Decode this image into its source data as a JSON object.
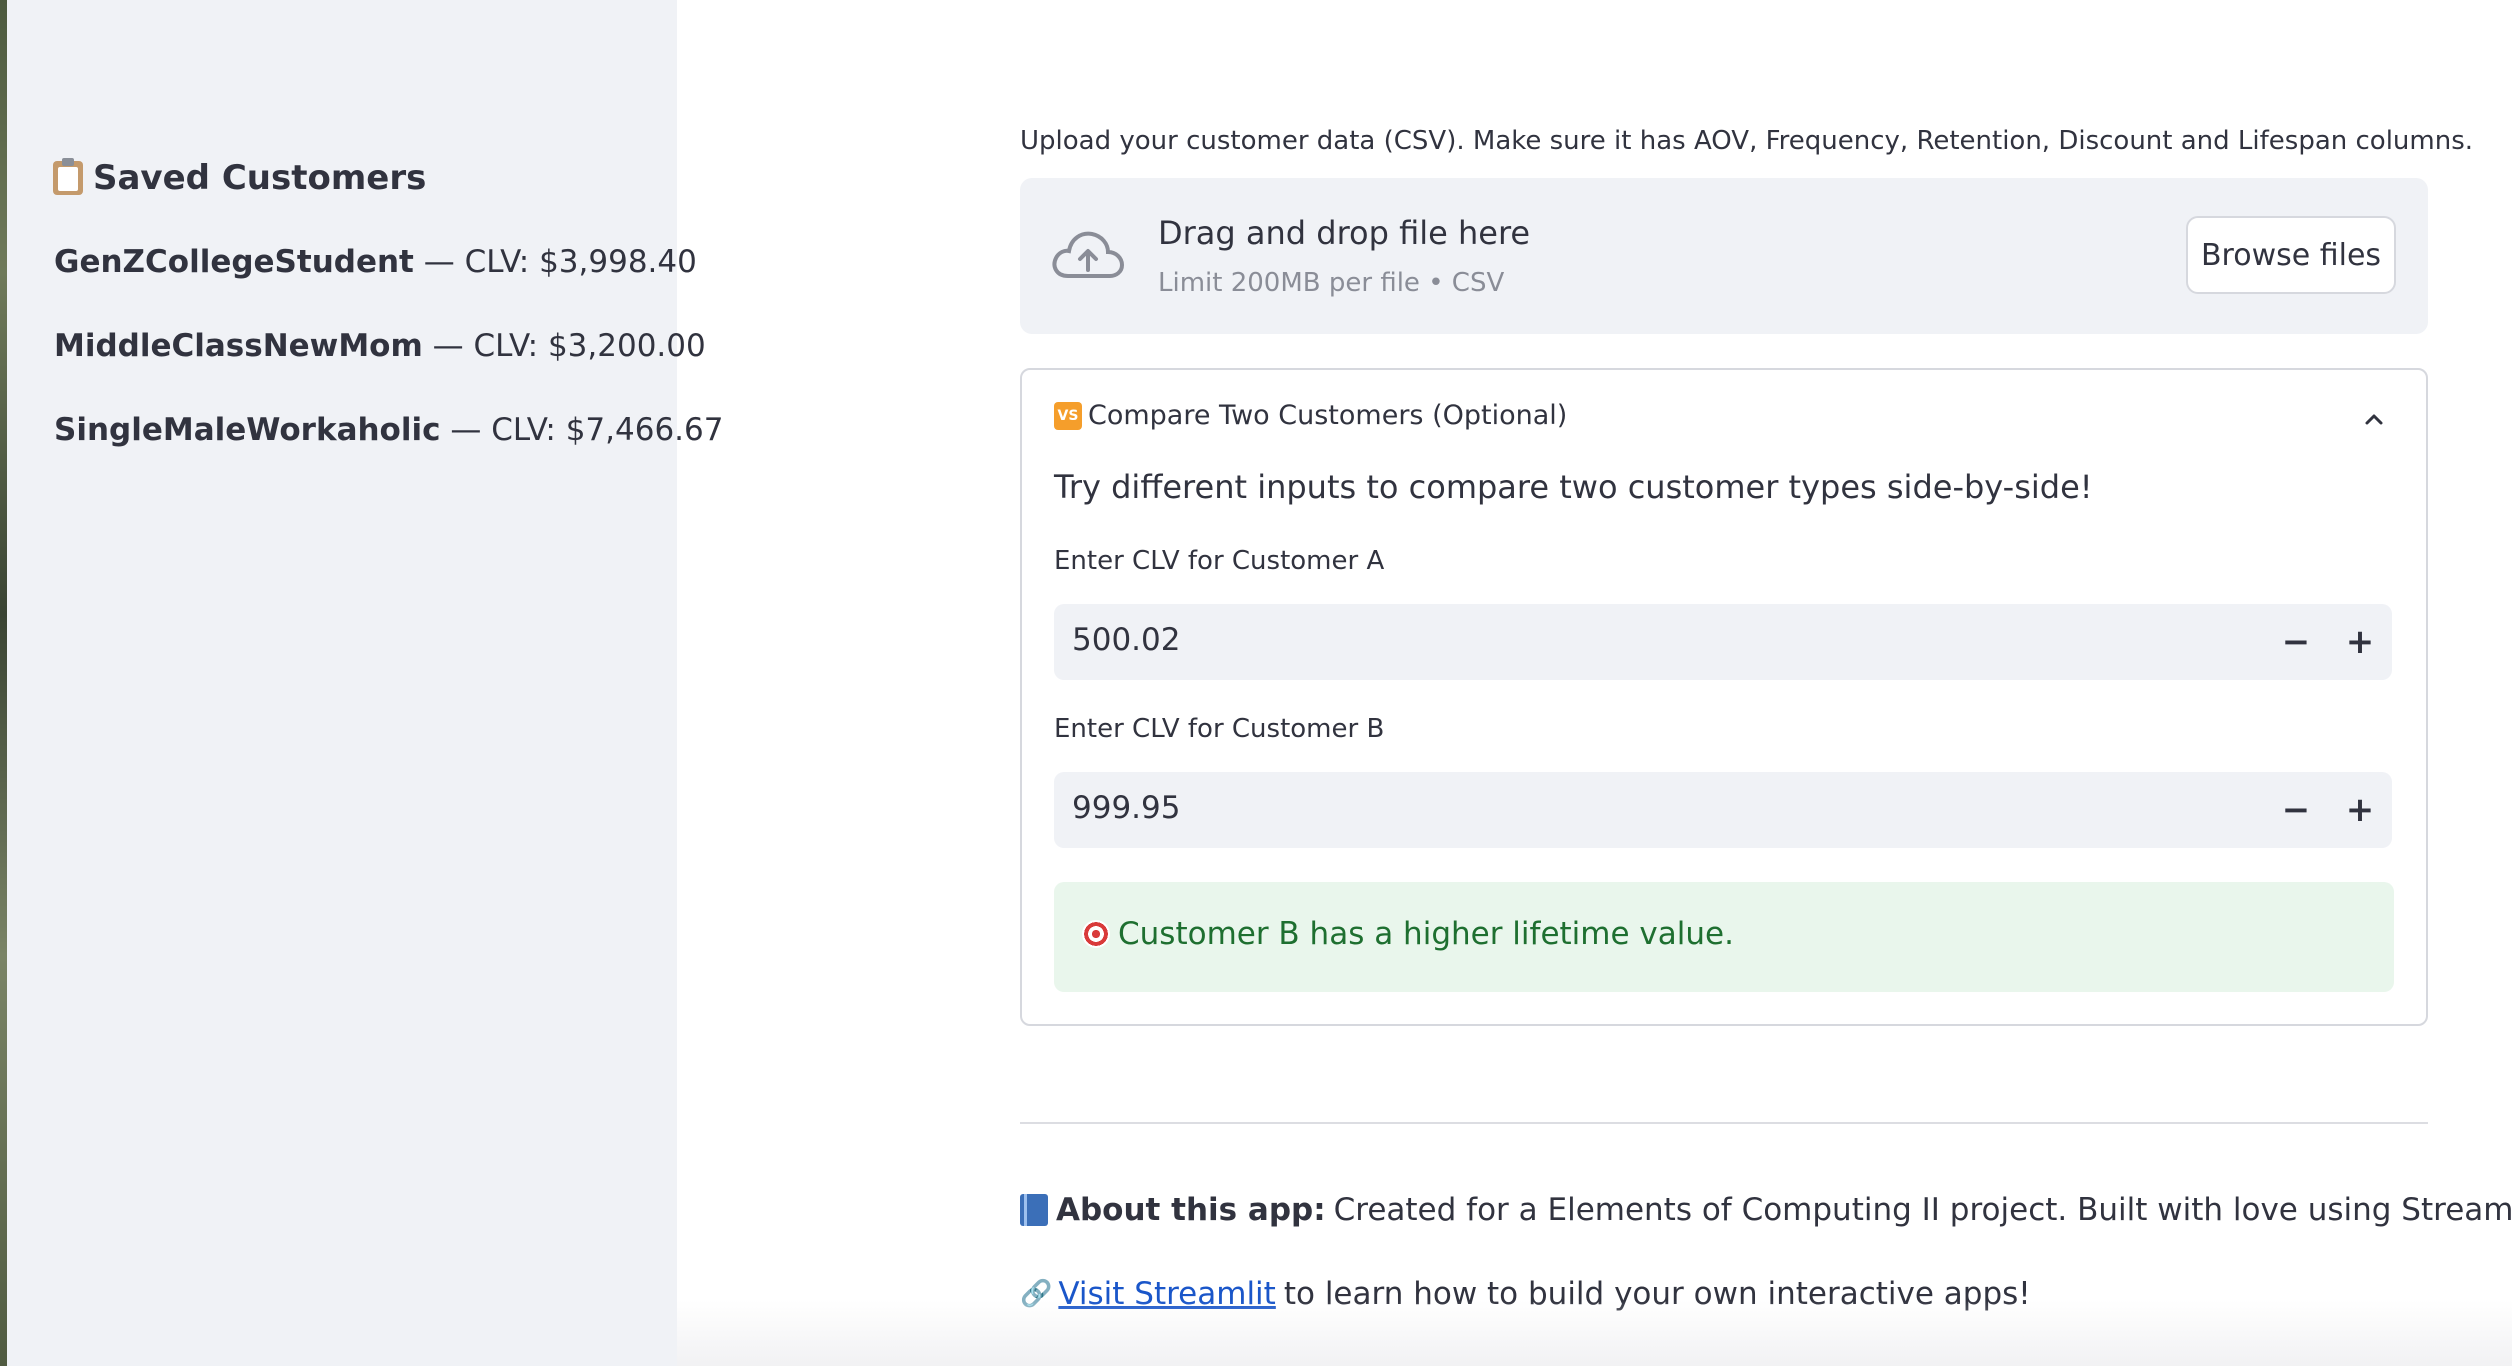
{
  "sidebar": {
    "title": "Saved Customers",
    "items": [
      {
        "name": "GenZCollegeStudent",
        "clv": " — CLV: $3,998.40"
      },
      {
        "name": "MiddleClassNewMom",
        "clv": " — CLV: $3,200.00"
      },
      {
        "name": "SingleMaleWorkaholic",
        "clv": " — CLV: $7,466.67"
      }
    ]
  },
  "upload": {
    "caption": "Upload your customer data (CSV). Make sure it has AOV, Frequency, Retention, Discount and Lifespan columns.",
    "drop_title": "Drag and drop file here",
    "drop_sub": "Limit 200MB per file • CSV",
    "browse_label": "Browse files"
  },
  "compare": {
    "header": "Compare Two Customers (Optional)",
    "vs_badge": "VS",
    "intro": "Try different inputs to compare two customer types side-by-side!",
    "customer_a": {
      "label": "Enter CLV for Customer A",
      "value": "500.02"
    },
    "customer_b": {
      "label": "Enter CLV for Customer B",
      "value": "999.95"
    },
    "result": "Customer B has a higher lifetime value."
  },
  "about": {
    "label": "About this app:",
    "text": "Created for a Elements of Computing II project. Built with love using Streamlit."
  },
  "visit": {
    "link_text": "Visit Streamlit",
    "rest": "to learn how to build your own interactive apps!"
  }
}
